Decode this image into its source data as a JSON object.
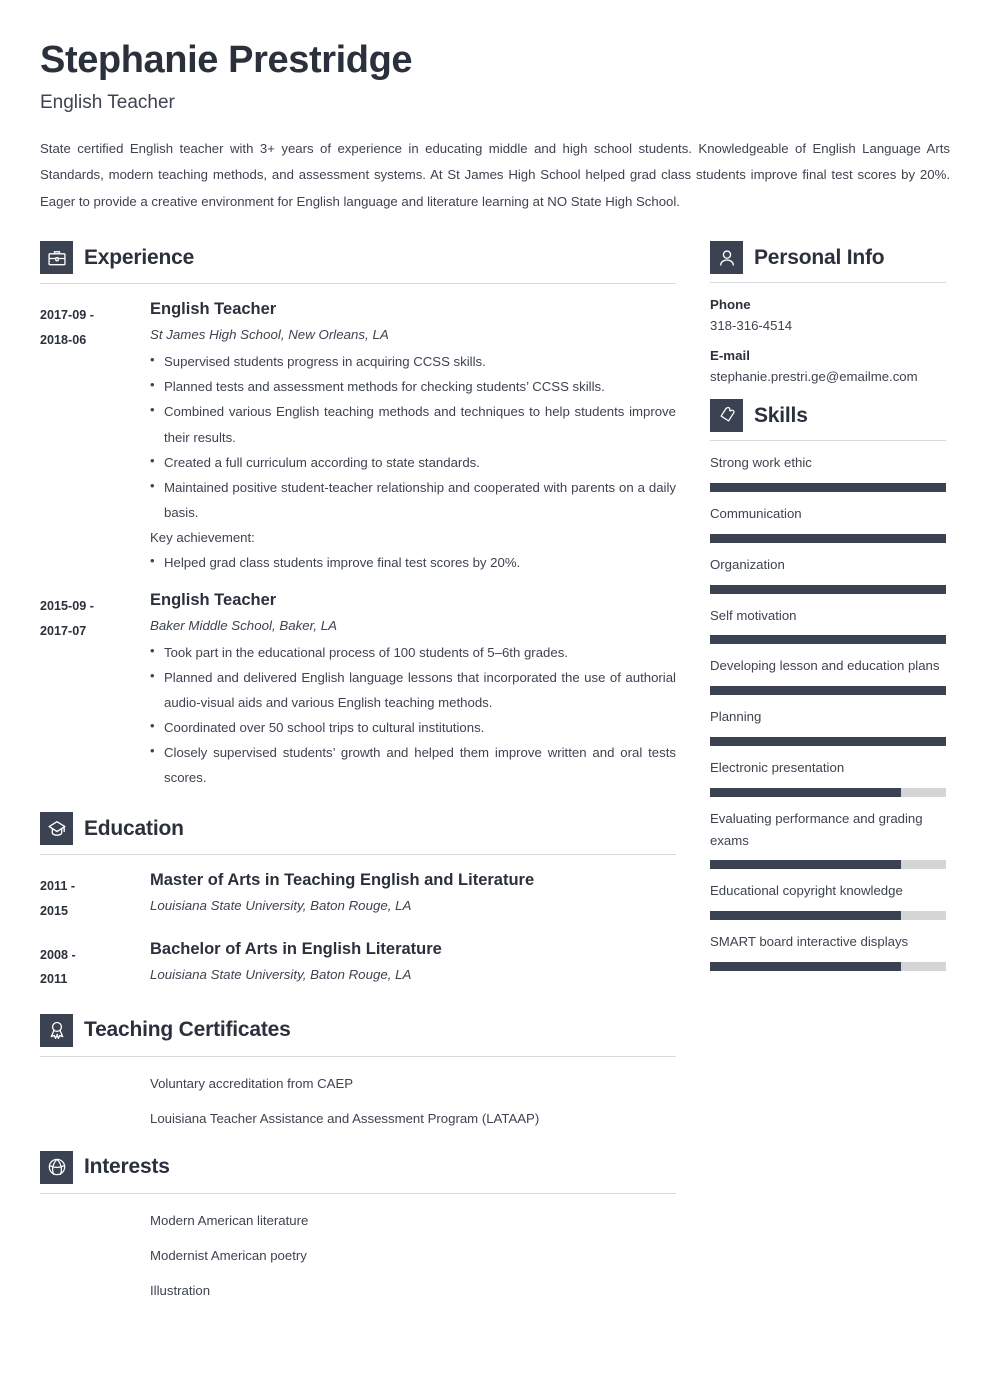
{
  "theme": {
    "dark": "#3b4252",
    "text": "#3d4350",
    "heading": "#2b313c",
    "rule": "#d8d9dc",
    "track": "#d4d5d7"
  },
  "header": {
    "name": "Stephanie Prestridge",
    "job_title": "English Teacher",
    "summary": "State certified English teacher with 3+ years of experience in educating middle and high school students. Knowledgeable of English Language Arts Standards, modern teaching methods, and assessment systems. At St James High School helped grad class students improve final test scores by 20%. Eager to provide a creative environment for English language and literature learning at NO State High School."
  },
  "experience": {
    "title": "Experience",
    "icon": "briefcase-icon",
    "entries": [
      {
        "date": "2017-09 - 2018-06",
        "date_line1": "2017-09 -",
        "date_line2": "2018-06",
        "title": "English Teacher",
        "subtitle": "St James High School, New Orleans, LA",
        "bullets": [
          "Supervised students progress in acquiring CCSS skills.",
          "Planned tests and assessment methods for checking students’ CCSS skills.",
          "Combined various English teaching methods and techniques to help students improve their results.",
          "Created a full curriculum according to state standards.",
          "Maintained positive student-teacher relationship and cooperated with parents on a daily basis."
        ],
        "key_achievement_label": "Key achievement:",
        "key_achievements": [
          "Helped grad class students improve final test scores by 20%."
        ]
      },
      {
        "date": "2015-09 - 2017-07",
        "date_line1": "2015-09 -",
        "date_line2": "2017-07",
        "title": "English Teacher",
        "subtitle": "Baker Middle School, Baker, LA",
        "bullets": [
          "Took part in the educational process of 100 students of 5–6th grades.",
          "Planned and delivered English language lessons that incorporated the use of authorial audio-visual aids and various English teaching methods.",
          "Coordinated over 50 school trips to cultural institutions.",
          "Closely supervised students’ growth and helped them improve written and oral tests scores."
        ],
        "key_achievement_label": "",
        "key_achievements": []
      }
    ]
  },
  "education": {
    "title": "Education",
    "icon": "graduation-cap-icon",
    "entries": [
      {
        "date_line1": "2011 -",
        "date_line2": "2015",
        "title": "Master of Arts in Teaching English and Literature",
        "subtitle": "Louisiana State University, Baton Rouge, LA"
      },
      {
        "date_line1": "2008 -",
        "date_line2": "2011",
        "title": "Bachelor of Arts in English Literature",
        "subtitle": "Louisiana State University, Baton Rouge, LA"
      }
    ]
  },
  "certificates": {
    "title": "Teaching Certificates",
    "icon": "award-ribbon-icon",
    "items": [
      "Voluntary accreditation from CAEP",
      "Louisiana Teacher Assistance and Assessment Program (LATAAP)"
    ]
  },
  "interests": {
    "title": "Interests",
    "icon": "dribbble-ball-icon",
    "items": [
      "Modern American literature",
      "Modernist American poetry",
      "Illustration"
    ]
  },
  "personal_info": {
    "title": "Personal Info",
    "icon": "person-icon",
    "fields": [
      {
        "label": "Phone",
        "value": "318-316-4514"
      },
      {
        "label": "E-mail",
        "value": "stephanie.prestri.ge@emailme.com"
      }
    ]
  },
  "skills": {
    "title": "Skills",
    "icon": "puzzle-piece-icon",
    "items": [
      {
        "name": "Strong work ethic",
        "level": 100
      },
      {
        "name": "Communication",
        "level": 100
      },
      {
        "name": "Organization",
        "level": 100
      },
      {
        "name": "Self motivation",
        "level": 100
      },
      {
        "name": "Developing lesson and education plans",
        "level": 100
      },
      {
        "name": "Planning",
        "level": 100
      },
      {
        "name": "Electronic presentation",
        "level": 81
      },
      {
        "name": "Evaluating performance and grading exams",
        "level": 81
      },
      {
        "name": "Educational copyright knowledge",
        "level": 81
      },
      {
        "name": "SMART board interactive displays",
        "level": 81
      }
    ]
  }
}
